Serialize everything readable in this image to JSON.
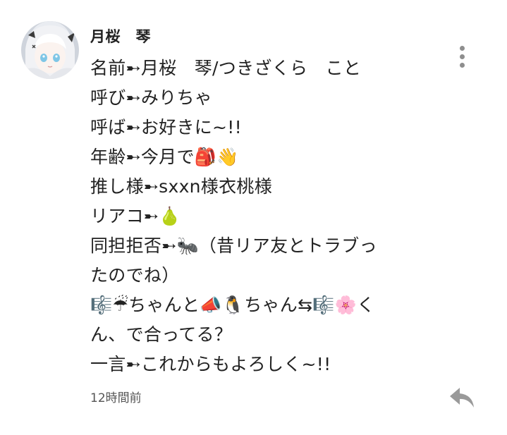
{
  "comment": {
    "username": "月桜　琴",
    "lines": [
      "名前➸月桜　琴/つきざくら　こと",
      "呼び➸みりちゃ",
      "呼ば➸お好きに~!!",
      "年齢➸今月で🎒👋",
      "推し様➸sxxn様衣桃様",
      "リアコ➸🍐",
      "同担拒否➸🐜（昔リア友とトラブっ",
      "たのでね）",
      "🎼☔ちゃんと📣🐧ちゃん⇆🎼🌸く",
      "ん、で合ってる？",
      "一言➸これからもよろしく~!!"
    ],
    "timestamp": "12時間前"
  },
  "icons": {
    "more": "more-vertical-icon",
    "reply": "reply-arrow-icon",
    "avatar": "avatar-image"
  },
  "colors": {
    "text": "#222222",
    "meta": "#555555",
    "icon": "#8e8e8e",
    "background": "#ffffff"
  }
}
